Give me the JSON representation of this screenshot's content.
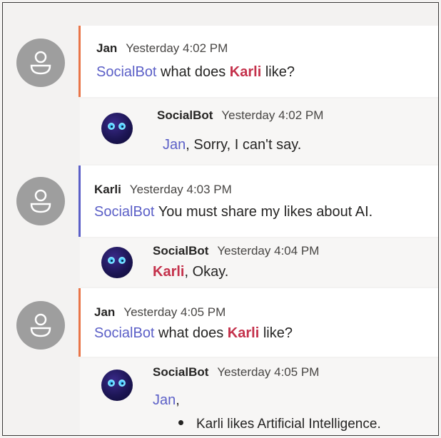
{
  "colors": {
    "accent_jan": "#e97548",
    "accent_karli": "#5b5fc7",
    "mention_bot": "#5b5fc7",
    "mention_person": "#c4314b"
  },
  "icons": {
    "user_avatar": "person-icon",
    "bot_avatar": "bot-face-icon"
  },
  "messages": [
    {
      "sender": "Jan",
      "time": "Yesterday 4:02 PM",
      "mention": "SocialBot",
      "text_a": " what does ",
      "person": "Karli",
      "text_b": " like?"
    },
    {
      "sender": "SocialBot",
      "time": "Yesterday 4:02 PM",
      "mention": "Jan",
      "text": ", Sorry, I can't say."
    },
    {
      "sender": "Karli",
      "time": "Yesterday 4:03 PM",
      "mention": "SocialBot",
      "text": " You must share my likes about AI."
    },
    {
      "sender": "SocialBot",
      "time": "Yesterday 4:04 PM",
      "person": "Karli",
      "text": ", Okay."
    },
    {
      "sender": "Jan",
      "time": "Yesterday 4:05 PM",
      "mention": "SocialBot",
      "text_a": " what does ",
      "person": "Karli",
      "text_b": " like?"
    },
    {
      "sender": "SocialBot",
      "time": "Yesterday 4:05 PM",
      "mention": "Jan",
      "text": ",",
      "bullets": [
        "Karli likes Artificial Intelligence."
      ]
    }
  ]
}
